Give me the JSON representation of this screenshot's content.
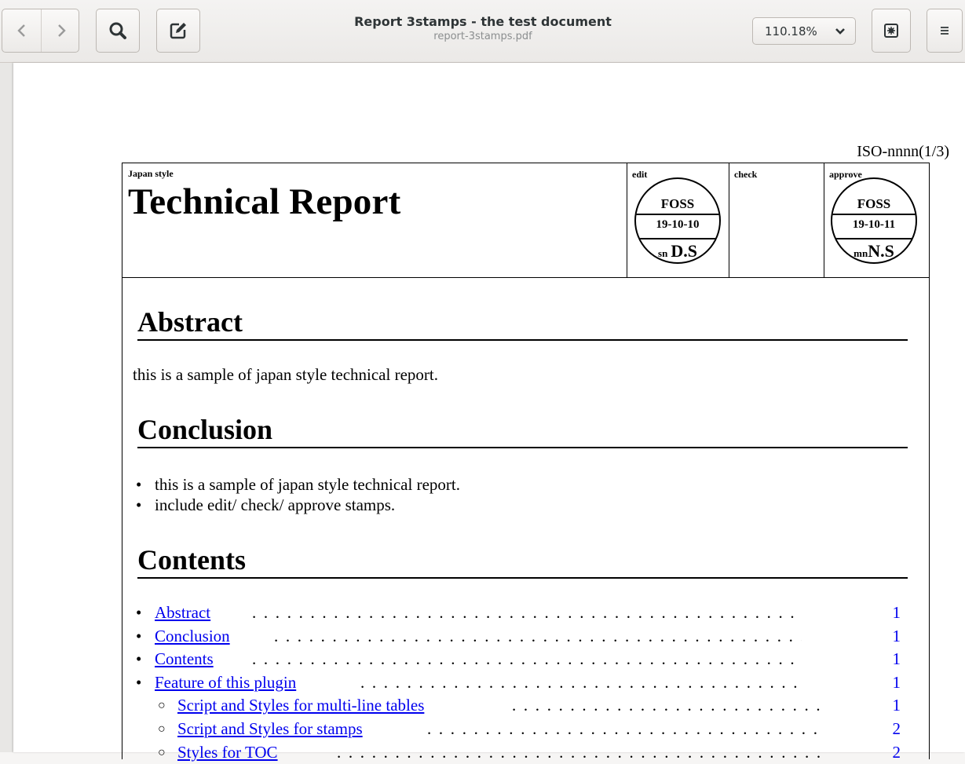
{
  "header": {
    "title": "Report 3stamps - the test document",
    "subtitle": "report-3stamps.pdf",
    "zoom_value": "110.18%",
    "icons": [
      "go-back-icon",
      "go-forward-icon",
      "search-icon",
      "annotate-icon",
      "chevron-down-icon",
      "sidebar-icon",
      "menu-icon"
    ]
  },
  "page": {
    "doc_id": "ISO-nnnn(1/3)",
    "style_label": "Japan style",
    "report_title": "Technical Report",
    "stamps": {
      "edit": {
        "label": "edit",
        "org": "FOSS",
        "date": "19-10-10",
        "initials_small": "sn",
        "initials": "D.S"
      },
      "check": {
        "label": "check"
      },
      "approve": {
        "label": "approve",
        "org": "FOSS",
        "date": "19-10-11",
        "initials_small": "mn",
        "initials": "N.S"
      }
    },
    "sections": {
      "abstract_heading": "Abstract",
      "abstract_text": "this is a sample of japan style technical report.",
      "conclusion_heading": "Conclusion",
      "conclusion_items": [
        "this is a sample of japan style technical report.",
        "include edit/ check/ approve stamps."
      ],
      "contents_heading": "Contents"
    },
    "toc": [
      {
        "label": "Abstract",
        "page": "1",
        "level": 1
      },
      {
        "label": "Conclusion",
        "page": "1",
        "level": 1
      },
      {
        "label": "Contents",
        "page": "1",
        "level": 1
      },
      {
        "label": "Feature of this plugin",
        "page": "1",
        "level": 1
      },
      {
        "label": "Script and Styles for multi-line tables",
        "page": "1",
        "level": 2
      },
      {
        "label": "Script and Styles for stamps",
        "page": "2",
        "level": 2
      },
      {
        "label": "Styles for TOC",
        "page": "2",
        "level": 2
      }
    ]
  }
}
